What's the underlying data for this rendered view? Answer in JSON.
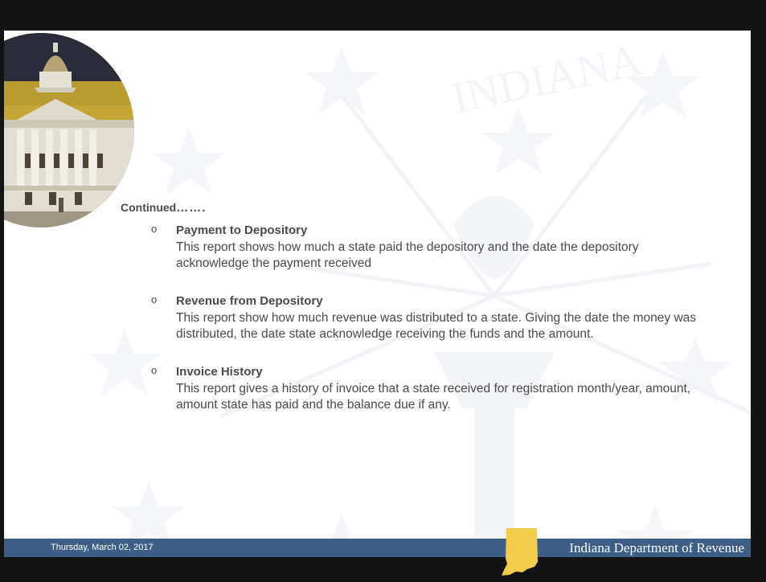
{
  "header": {
    "continued_label": "Continued",
    "continued_dots": "……."
  },
  "items": [
    {
      "bullet": "o",
      "title": "Payment to Depository",
      "description": "This report shows how much a state paid the depository and the date the depository acknowledge the payment received"
    },
    {
      "bullet": "o",
      "title": "Revenue from Depository",
      "description": "This report show how much revenue was distributed to a state. Giving the date the money was distributed, the date state acknowledge receiving the funds and the amount."
    },
    {
      "bullet": "o",
      "title": "Invoice History",
      "description": "This report gives a history of invoice that a state received for registration month/year, amount, amount state has paid and the balance due if any."
    }
  ],
  "footer": {
    "date": "Thursday, March 02, 2017",
    "organization": "Indiana Department of Revenue"
  },
  "watermark": {
    "text": "INDIANA"
  },
  "colors": {
    "footer_bar": "#3d5e86",
    "state_shape": "#f2cc4a",
    "text": "#4a4a4a"
  }
}
